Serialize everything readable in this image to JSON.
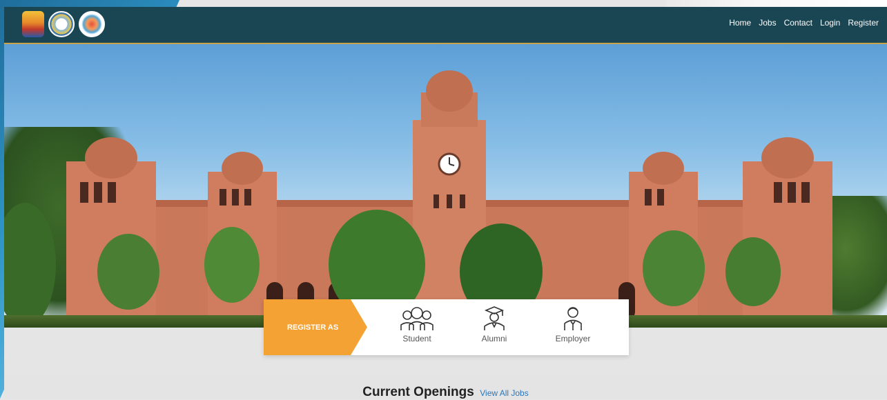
{
  "nav": {
    "links": [
      "Home",
      "Jobs",
      "Contact",
      "Login",
      "Register"
    ]
  },
  "logos": [
    "punjab-university-logo",
    "seal-logo",
    "puao-logo"
  ],
  "register": {
    "label": "REGISTER AS",
    "options": [
      {
        "label": "Student",
        "icon": "students-icon"
      },
      {
        "label": "Alumni",
        "icon": "graduate-icon"
      },
      {
        "label": "Employer",
        "icon": "employer-icon"
      }
    ]
  },
  "openings": {
    "title": "Current Openings",
    "link": "View All Jobs"
  },
  "colors": {
    "navbar": "#1a4553",
    "accent": "#f4a233",
    "link": "#2b75b9"
  }
}
